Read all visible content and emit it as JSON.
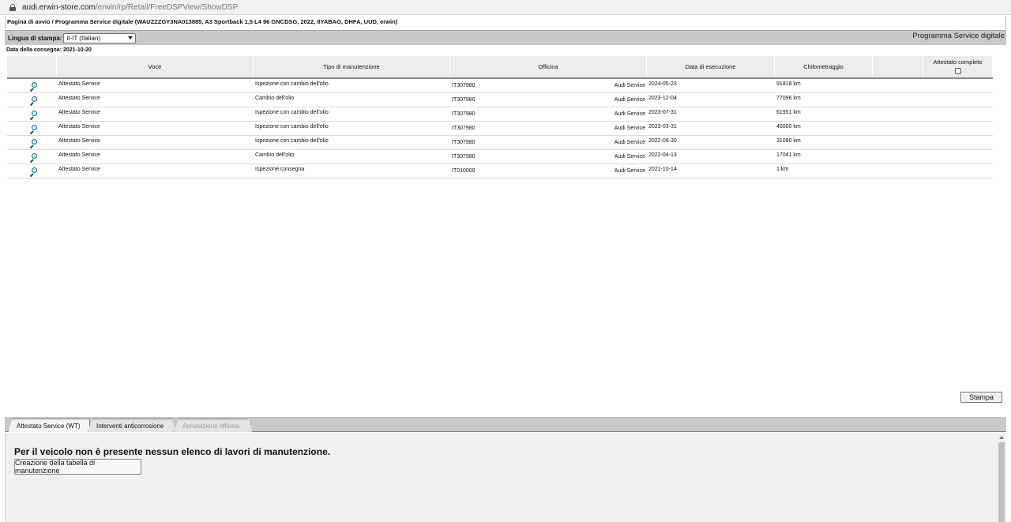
{
  "browser": {
    "url_host": "audi.erwin-store.com",
    "url_path": "/erwin/rp/Retail/FreeDSPView/ShowDSP"
  },
  "breadcrumb": "Pagina di avvio / Programma Service digitale (WAUZZZGY3NA013885, A3 Sportback 1,5 L4 96 GNCDSG, 2022, 8YABAG, DHFA, UUD, erwin)",
  "lang": {
    "label": "Lingua di stampa:",
    "selected": "it-IT (Italian)",
    "program_title": "Programma Service digitale"
  },
  "delivery_date": "Data della consegna: 2021-10-20",
  "table": {
    "headers": {
      "voce": "Voce",
      "tipo": "Tipo di manutenzione",
      "officina": "Officina",
      "data": "Data di esecuzione",
      "km": "Chilometraggio",
      "attestato": "Attestato completo"
    },
    "rows": [
      {
        "voce": "Attestato Service",
        "tipo": "Ispezione con cambio dell'olio",
        "code": "IT307980",
        "workshop": "Audi Service",
        "date": "2024-05-23",
        "km": "91818 km"
      },
      {
        "voce": "Attestato Service",
        "tipo": "Cambio dell'olio",
        "code": "IT307980",
        "workshop": "Audi Service",
        "date": "2023-12-04",
        "km": "77096 km"
      },
      {
        "voce": "Attestato Service",
        "tipo": "Ispezione con cambio dell'olio",
        "code": "IT307980",
        "workshop": "Audi Service",
        "date": "2023-07-31",
        "km": "61951 km"
      },
      {
        "voce": "Attestato Service",
        "tipo": "Ispezione con cambio dell'olio",
        "code": "IT307980",
        "workshop": "Audi Service",
        "date": "2023-03-31",
        "km": "45000 km"
      },
      {
        "voce": "Attestato Service",
        "tipo": "Ispezione con cambio dell'olio",
        "code": "IT307980",
        "workshop": "Audi Service",
        "date": "2022-09-30",
        "km": "31080 km"
      },
      {
        "voce": "Attestato Service",
        "tipo": "Cambio dell'olio",
        "code": "IT307980",
        "workshop": "Audi Service",
        "date": "2022-04-13",
        "km": "17041 km"
      },
      {
        "voce": "Attestato Service",
        "tipo": "Ispezione consegna",
        "code": "IT010000",
        "workshop": "Audi Service",
        "date": "2021-10-14",
        "km": "1 km"
      }
    ]
  },
  "print_button": "Stampa",
  "tabs": [
    "Attestato Service (WT)",
    "Interventi anticorrosione",
    "Annotazione officina"
  ],
  "panel": {
    "message": "Per il veicolo non è presente nessun elenco di lavori di manutenzione.",
    "create_button": "Creazione della tabella di manutenzione"
  }
}
